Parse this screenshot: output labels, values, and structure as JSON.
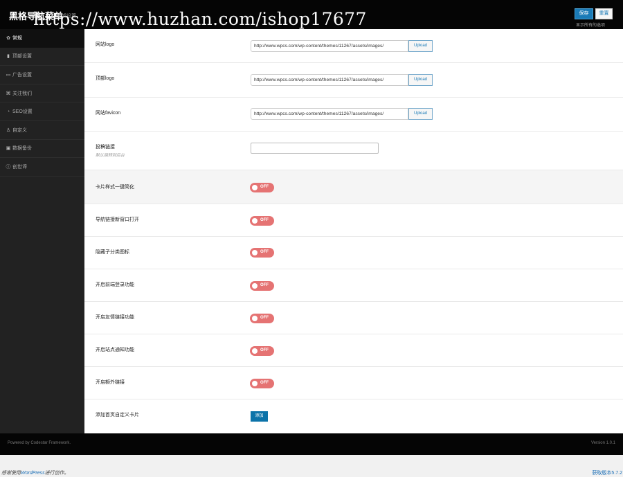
{
  "header": {
    "title": "黑格导航菜单",
    "subtitle": "框架设置",
    "watermark": "https://www.huzhan.com/ishop17677",
    "save_label": "保存",
    "reset_label": "重置",
    "note": "显示所有的选项"
  },
  "sidebar": {
    "items": [
      {
        "icon": "gear-icon",
        "glyph": "✿",
        "label": "常规"
      },
      {
        "icon": "bookmark-icon",
        "glyph": "▮",
        "label": "顶部设置"
      },
      {
        "icon": "ad-icon",
        "glyph": "▭",
        "label": "广告设置"
      },
      {
        "icon": "follow-icon",
        "glyph": "⌘",
        "label": "关注我们"
      },
      {
        "icon": "seo-icon",
        "glyph": "◔",
        "label": "SEO设置"
      },
      {
        "icon": "person-icon",
        "glyph": "♙",
        "label": "自定义"
      },
      {
        "icon": "backup-icon",
        "glyph": "▣",
        "label": "数据备份"
      },
      {
        "icon": "info-icon",
        "glyph": "ⓘ",
        "label": "创世谛"
      }
    ]
  },
  "main": {
    "upload_label": "Upload",
    "toggle_label": "OFF",
    "url_value": "http://www.wpcs.com/wp-content/themes/11267/assets/images/",
    "rows": [
      {
        "type": "upload",
        "label": "网站logo"
      },
      {
        "type": "upload",
        "label": "顶部logo"
      },
      {
        "type": "upload",
        "label": "网站favicon"
      },
      {
        "type": "input",
        "label": "投稿链接",
        "hint": "默认跳转到后台"
      },
      {
        "type": "toggle",
        "label": "卡片样式一键简化"
      },
      {
        "type": "toggle",
        "label": "导航链接新窗口打开"
      },
      {
        "type": "toggle",
        "label": "隐藏子分类图标"
      },
      {
        "type": "toggle",
        "label": "开启前端登录功能"
      },
      {
        "type": "toggle",
        "label": "开启友情链接功能"
      },
      {
        "type": "toggle",
        "label": "开启站点通知功能"
      },
      {
        "type": "toggle",
        "label": "开启额外链接"
      },
      {
        "type": "button",
        "label": "添加首页自定义卡片",
        "button_label": "添加"
      }
    ]
  },
  "footer": {
    "powered": "Powered by Codestar Framework.",
    "version": "Version 1.0.1",
    "thanks_prefix": "感谢使用",
    "thanks_link": "WordPress",
    "thanks_suffix": "进行创作。",
    "get_version": "获取版本5.7.2"
  },
  "colors": {
    "accent": "#1b7bb7",
    "toggle_off": "#e57373",
    "sidebar_bg": "#222222",
    "topbar_bg": "#050505"
  }
}
